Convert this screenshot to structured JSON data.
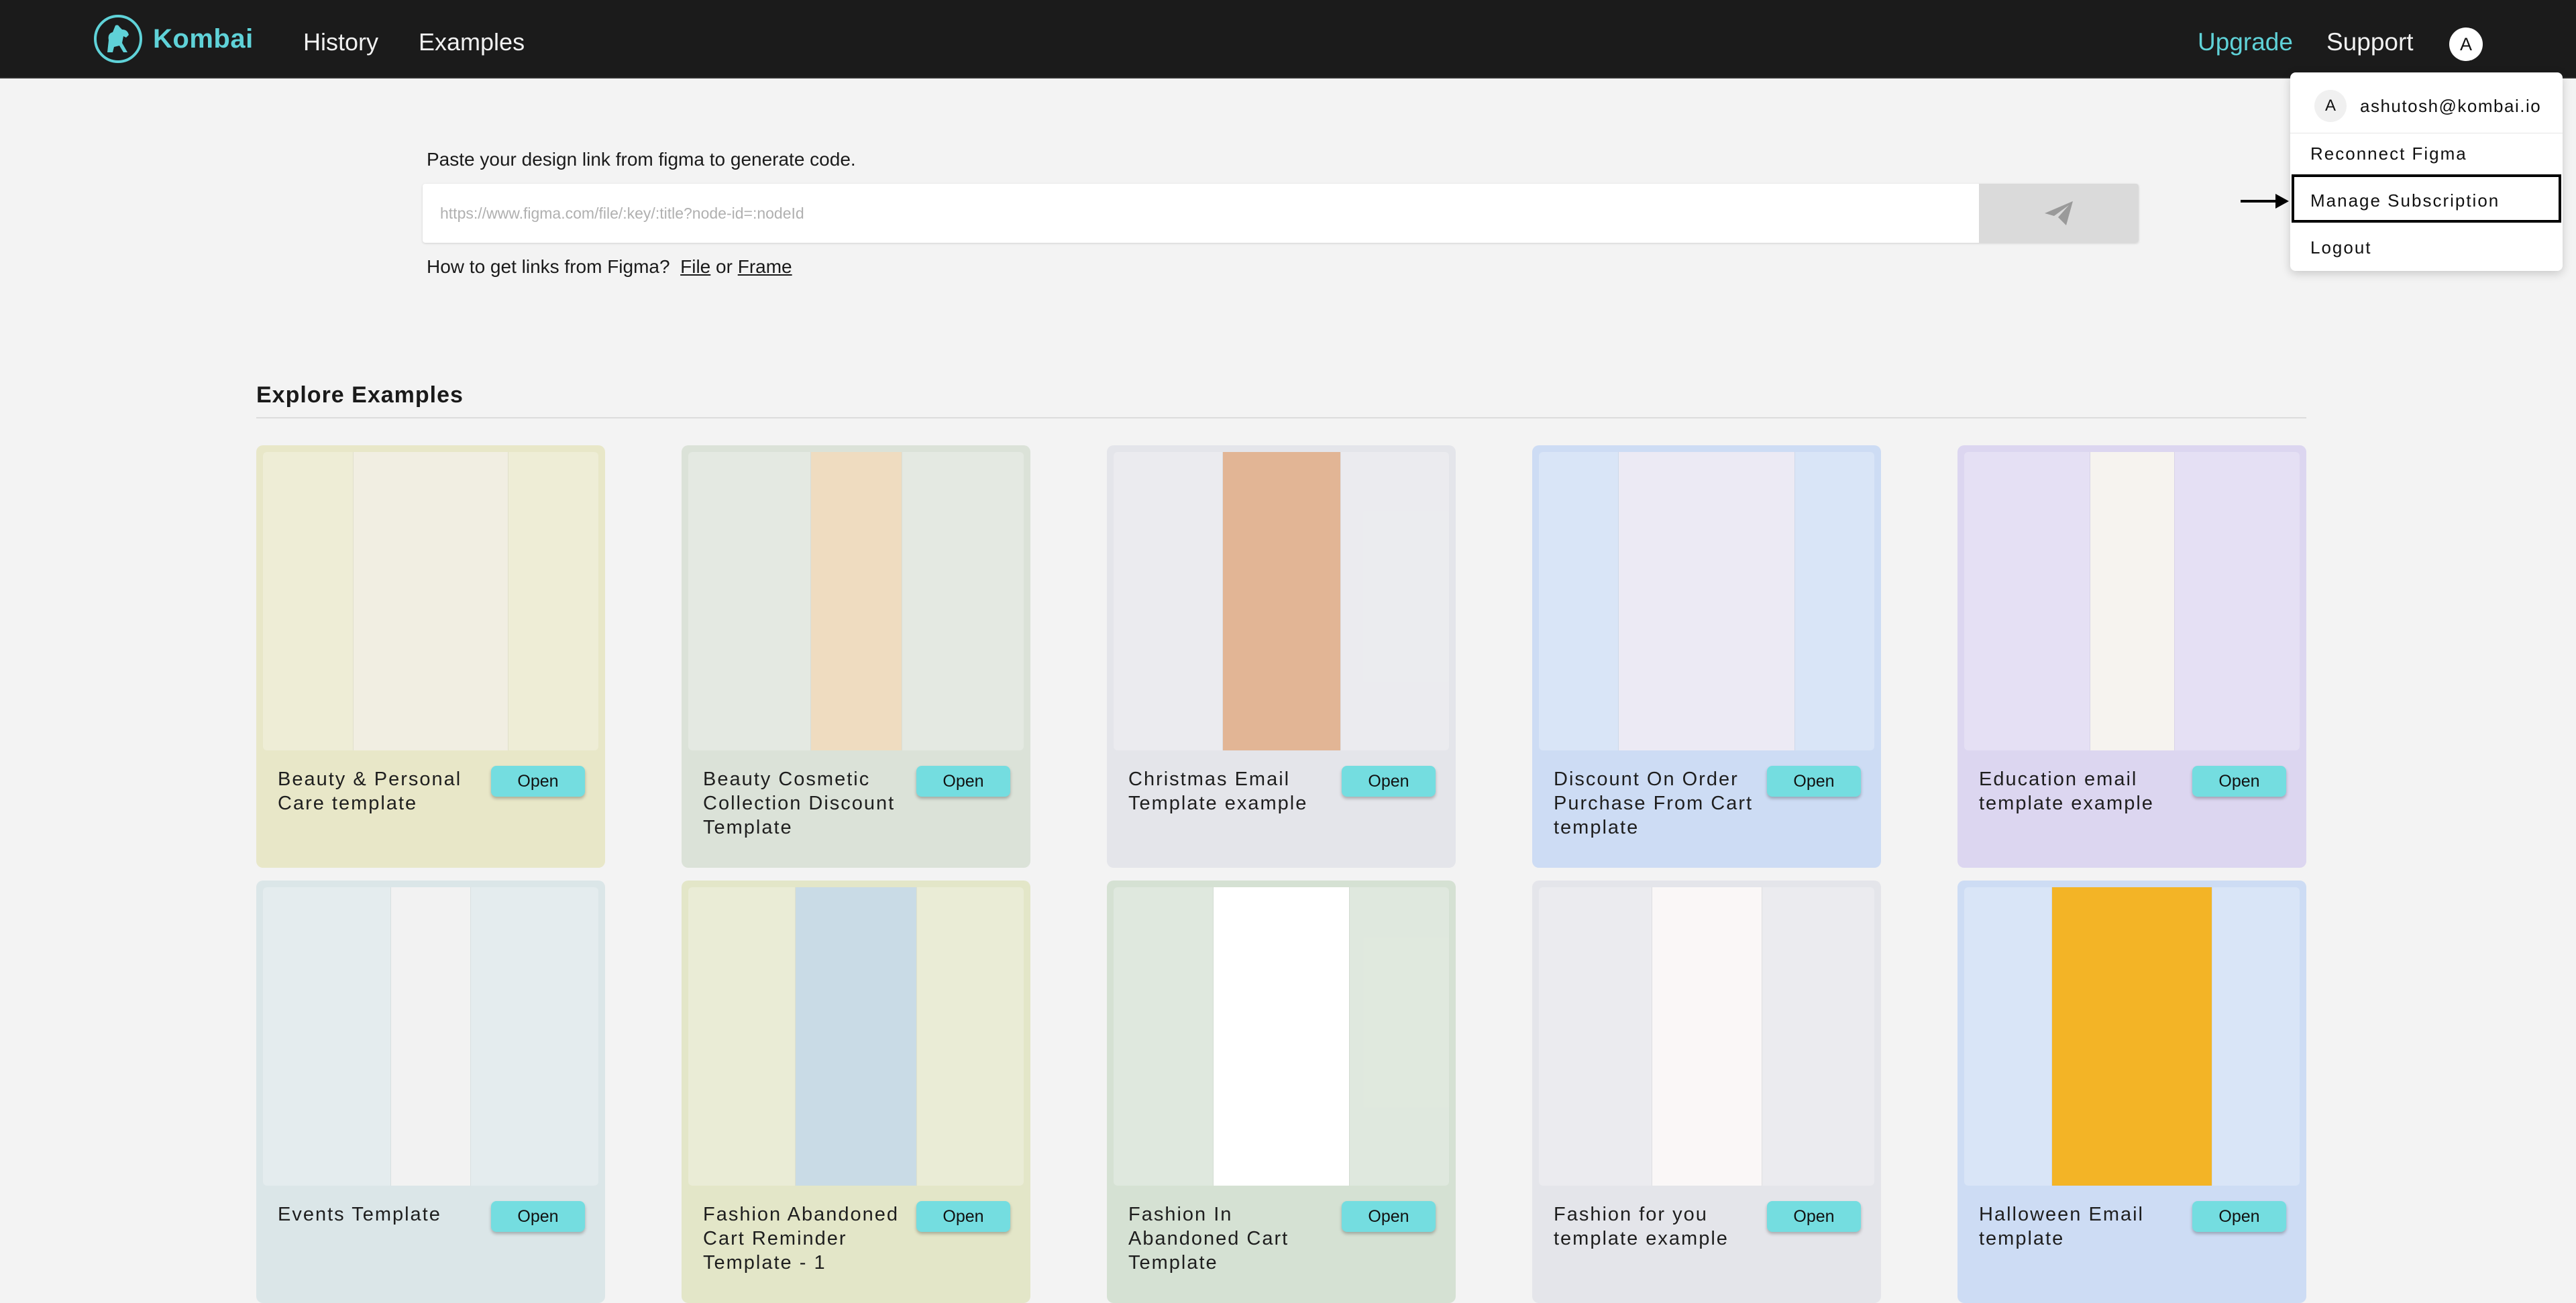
{
  "header": {
    "brand": "Kombai",
    "nav": {
      "history": "History",
      "examples": "Examples"
    },
    "upgrade": "Upgrade",
    "support": "Support",
    "avatar_initial": "A",
    "colors": {
      "bar": "#1b1b1b",
      "accent": "#5fd2d8"
    }
  },
  "figma_input": {
    "instruction": "Paste your design link from figma to generate code.",
    "placeholder": "https://www.figma.com/file/:key/:title?node-id=:nodeId",
    "value": "",
    "send_icon": "paper-plane-icon",
    "help_prefix": "How to get links from Figma?",
    "help_file": "File",
    "help_or": "or",
    "help_frame": "Frame"
  },
  "explore": {
    "title": "Explore Examples",
    "open_label": "Open",
    "cards": [
      {
        "title": "Beauty & Personal Care template",
        "bg": "#e8e7c8",
        "thumb": "#f1eee2"
      },
      {
        "title": "Beauty Cosmetic Collection Discount Template",
        "bg": "#dbe2d8",
        "thumb": "#efdcc0"
      },
      {
        "title": "Christmas Email Template example",
        "bg": "#e4e5ea",
        "thumb": "#e2b595"
      },
      {
        "title": "Discount On Order Purchase From Cart template",
        "bg": "#cddcf4",
        "thumb": "#eceaf4"
      },
      {
        "title": "Education email template example",
        "bg": "#dcd6f0",
        "thumb": "#f6f3ef"
      },
      {
        "title": "Events Template",
        "bg": "#dbe6e8",
        "thumb": "#f2f2f2"
      },
      {
        "title": "Fashion Abandoned Cart Reminder Template - 1",
        "bg": "#e3e6c8",
        "thumb": "#c9dbe6"
      },
      {
        "title": "Fashion In Abandoned Cart Template",
        "bg": "#d5e1d3",
        "thumb": "#ffffff"
      },
      {
        "title": "Fashion for you template example",
        "bg": "#e4e5ea",
        "thumb": "#faf7f7"
      },
      {
        "title": "Halloween Email template",
        "bg": "#cddcf4",
        "thumb": "#f3b426"
      }
    ]
  },
  "user_menu": {
    "avatar_initial": "A",
    "email": "ashutosh@kombai.io",
    "items": [
      "Reconnect Figma",
      "Manage Subscription",
      "Logout"
    ],
    "highlighted": "Manage Subscription"
  }
}
